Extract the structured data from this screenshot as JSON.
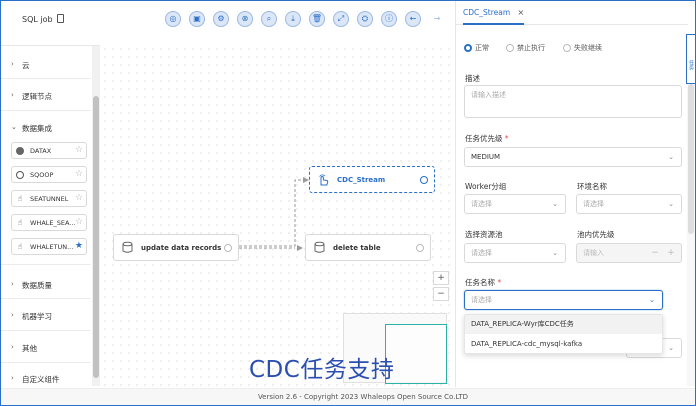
{
  "header": {
    "job_title": "SQL job",
    "toolbar": [
      {
        "icon": "search-icon",
        "glyph": "◎"
      },
      {
        "icon": "save-icon",
        "glyph": "▣"
      },
      {
        "icon": "settings-icon",
        "glyph": "⚙"
      },
      {
        "icon": "close-circle-icon",
        "glyph": "⊗"
      },
      {
        "icon": "zoom-icon",
        "glyph": "⌕"
      },
      {
        "icon": "download-icon",
        "glyph": "⤓"
      },
      {
        "icon": "delete-icon",
        "glyph": "🗑"
      },
      {
        "icon": "fullscreen-icon",
        "glyph": "⤢"
      },
      {
        "icon": "format-icon",
        "glyph": "⛭"
      },
      {
        "icon": "info-icon",
        "glyph": "ⓘ"
      },
      {
        "icon": "arrow-left-icon",
        "glyph": "←"
      },
      {
        "icon": "arrow-right-icon",
        "glyph": "→"
      }
    ]
  },
  "sidebar": {
    "categories": [
      "云",
      "逻辑节点",
      "数据集成",
      "数据质量",
      "机器学习",
      "其他",
      "自定义组件"
    ],
    "tasks": [
      {
        "label": "DATAX",
        "icon": "datax-icon",
        "starred": false
      },
      {
        "label": "SQOOP",
        "icon": "sqoop-icon",
        "starred": false
      },
      {
        "label": "SEATUNNEL",
        "icon": "seatunnel-icon",
        "starred": false
      },
      {
        "label": "WHALE_SEA...",
        "icon": "whale-seatunnel-icon",
        "starred": false
      },
      {
        "label": "WHALETUN...",
        "icon": "whaletunnel-icon",
        "starred": true
      }
    ]
  },
  "canvas": {
    "nodes": {
      "cdc": "CDC_Stream",
      "update": "update data records",
      "delete": "delete table"
    },
    "zoom_in": "+",
    "zoom_out": "−",
    "overlay_caption": "CDC任务支持"
  },
  "footer": {
    "text": "Version 2.6 - Copyright 2023 Whaleops Open Source Co.LTD"
  },
  "panel": {
    "tab_title": "CDC_Stream",
    "tab_close": "×",
    "run_flag": {
      "options": [
        "正常",
        "禁止执行",
        "失败继续"
      ],
      "selected": "正常"
    },
    "description": {
      "label": "描述",
      "placeholder": "请输入描述"
    },
    "priority": {
      "label": "任务优先级",
      "required": "*",
      "value": "MEDIUM"
    },
    "worker_group": {
      "label": "Worker分组",
      "placeholder": "请选择"
    },
    "env_name": {
      "label": "环境名称",
      "placeholder": "请选择"
    },
    "resource_pool": {
      "label": "选择资源池",
      "placeholder": "请选择"
    },
    "pool_priority": {
      "label": "池内优先级",
      "placeholder": "请输入",
      "minus": "−",
      "plus": "+"
    },
    "task_name": {
      "label": "任务名称",
      "required": "*",
      "placeholder": "请选择"
    },
    "task_options": [
      "DATA_REPLICA-Wyr库CDC任务",
      "DATA_REPLICA-cdc_mysql-kafka"
    ],
    "side_tab": "任务"
  },
  "colors": {
    "accent": "#2a6fc9",
    "overlay_text": "#2a4fb0",
    "minimap_view": "#2bb3a6",
    "required": "#e04a4a"
  }
}
